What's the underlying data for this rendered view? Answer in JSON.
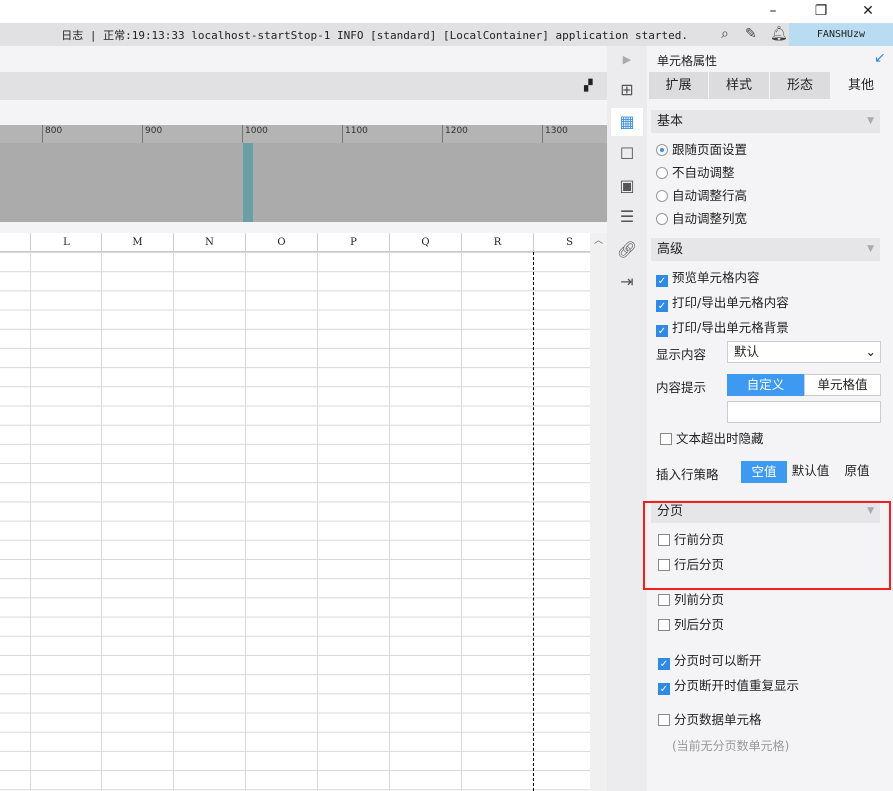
{
  "window": {
    "minimize": "–",
    "restore": "❐",
    "close": "✕"
  },
  "logbar": {
    "text": "日志 | 正常:19:13:33 localhost-startStop-1 INFO [standard] [LocalContainer] application started.",
    "user": "FANSHUzw"
  },
  "ruler": {
    "ticks": [
      "800",
      "900",
      "1000",
      "1100",
      "1200",
      "1300"
    ]
  },
  "columns": [
    "L",
    "M",
    "N",
    "O",
    "P",
    "Q",
    "R",
    "S"
  ],
  "panel": {
    "title": "单元格属性",
    "tabs": [
      "扩展",
      "样式",
      "形态",
      "其他"
    ],
    "active_tab": "其他",
    "basic": {
      "title": "基本",
      "options": [
        "跟随页面设置",
        "不自动调整",
        "自动调整行高",
        "自动调整列宽"
      ],
      "selected": 0
    },
    "advanced": {
      "title": "高级",
      "checks": [
        {
          "label": "预览单元格内容",
          "checked": true
        },
        {
          "label": "打印/导出单元格内容",
          "checked": true
        },
        {
          "label": "打印/导出单元格背景",
          "checked": true
        }
      ],
      "display_label": "显示内容",
      "display_value": "默认",
      "tip_label": "内容提示",
      "tip_options": [
        "自定义",
        "单元格值"
      ],
      "hide_overflow": "文本超出时隐藏",
      "insert_label": "插入行策略",
      "insert_options": [
        "空值",
        "默认值",
        "原值"
      ]
    },
    "paging": {
      "title": "分页",
      "checks": [
        {
          "label": "行前分页",
          "checked": false
        },
        {
          "label": "行后分页",
          "checked": false
        },
        {
          "label": "列前分页",
          "checked": false
        },
        {
          "label": "列后分页",
          "checked": false
        },
        {
          "label": "分页时可以断开",
          "checked": true
        },
        {
          "label": "分页断开时值重复显示",
          "checked": true
        },
        {
          "label": "分页数据单元格",
          "checked": false
        }
      ],
      "note": "(当前无分页数单元格)"
    }
  },
  "colors": {
    "accent": "#3d9af0",
    "highlight_box": "#f02020"
  }
}
